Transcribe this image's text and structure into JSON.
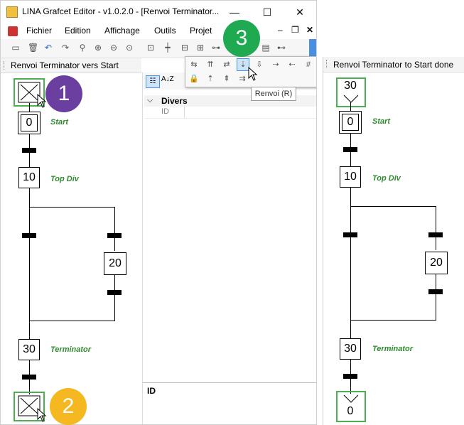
{
  "window": {
    "title": "LINA Grafcet Editor - v1.0.2.0 - [Renvoi Terminator...",
    "minimize": "—",
    "maximize": "☐",
    "close": "✕"
  },
  "menu": {
    "items": [
      "Fichier",
      "Edition",
      "Affichage",
      "Outils",
      "Projet"
    ],
    "mdi_min": "–",
    "mdi_restore": "❐",
    "mdi_close": "✕"
  },
  "toolbar": {
    "icons": [
      "new-icon",
      "delete-icon",
      "undo-icon",
      "redo-icon",
      "zoom-icon",
      "zoom-in-icon",
      "zoom-out-icon",
      "zoom-fit-icon",
      "step-icon",
      "transition-icon",
      "macro-step-icon",
      "action-icon",
      "link-icon",
      "comment-icon",
      "terminator-icon"
    ]
  },
  "left_tab": {
    "label": "Renvoi Terminator vers Start"
  },
  "right_tab": {
    "label": "Renvoi Terminator to Start done"
  },
  "properties": {
    "category": "Divers",
    "field": "ID",
    "description_title": "ID",
    "sort_icon": "A↓Z"
  },
  "popup": {
    "tooltip": "Renvoi (R)",
    "row1": [
      "⇆",
      "⇈",
      "⇄",
      "⇣",
      "⇩",
      "⇢",
      "⇠",
      "#"
    ],
    "row2": [
      "🔒",
      "⇡",
      "⇞",
      "⇉"
    ]
  },
  "left_diagram": {
    "steps": [
      {
        "num": "0",
        "label": "Start"
      },
      {
        "num": "10",
        "label": "Top Div"
      },
      {
        "num": "20",
        "label": ""
      },
      {
        "num": "30",
        "label": "Terminator"
      }
    ]
  },
  "right_diagram": {
    "top_renvoi": "30",
    "bottom_renvoi": "0",
    "steps": [
      {
        "num": "0",
        "label": "Start"
      },
      {
        "num": "10",
        "label": "Top Div"
      },
      {
        "num": "20",
        "label": ""
      },
      {
        "num": "30",
        "label": "Terminator"
      }
    ]
  },
  "badges": [
    {
      "num": "1",
      "color": "#6b3fa0"
    },
    {
      "num": "2",
      "color": "#f5b820"
    },
    {
      "num": "3",
      "color": "#1faa52"
    }
  ],
  "colors": {
    "highlight_green": "#4caf50",
    "label_green": "#2e8b2e"
  }
}
